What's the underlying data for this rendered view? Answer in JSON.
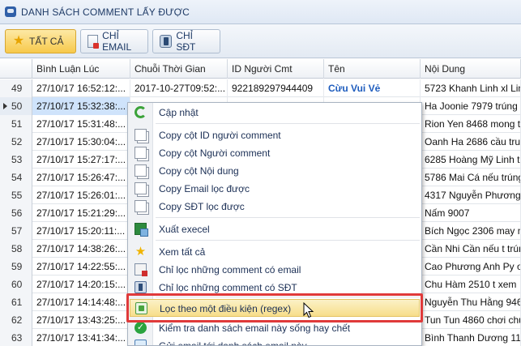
{
  "window": {
    "title": "DANH SÁCH COMMENT LẤY ĐƯỢC",
    "icon": "comment-icon"
  },
  "toolbar": {
    "all_label": "TẤT CẢ",
    "email_label": "CHỈ EMAIL",
    "phone_label": "CHỈ SĐT"
  },
  "grid": {
    "columns": [
      "Bình Luận Lúc",
      "Chuỗi Thời Gian",
      "ID Người Cmt",
      "Tên",
      "Nội Dung"
    ],
    "rows": [
      {
        "num": "49",
        "time": "27/10/17 16:52:12:...",
        "timestamp": "2017-10-27T09:52:...",
        "user_id": "922189297944409",
        "name": "Cừu Vui Vẻ",
        "content": "5723 Khanh Linh xl Lin"
      },
      {
        "num": "50",
        "time": "27/10/17 15:32:38:...",
        "content": "Ha Joonie 7979 trúng c"
      },
      {
        "num": "51",
        "time": "27/10/17 15:31:48:...",
        "content": "Rion Yen 8468 mong tr"
      },
      {
        "num": "52",
        "time": "27/10/17 15:30:04:...",
        "content": "Oanh Ha  2686  cầu tru"
      },
      {
        "num": "53",
        "time": "27/10/17 15:27:17:...",
        "content": "6285 Hoàng Mỹ Linh t"
      },
      {
        "num": "54",
        "time": "27/10/17 15:26:47:...",
        "content": "5786 Mai Cá nếu trúng"
      },
      {
        "num": "55",
        "time": "27/10/17 15:26:01:...",
        "content": "4317 Nguyễn Phương"
      },
      {
        "num": "56",
        "time": "27/10/17 15:21:29:...",
        "content": "Nấm 9007"
      },
      {
        "num": "57",
        "time": "27/10/17 15:20:11:...",
        "content": "Bích Ngọc 2306 may n"
      },
      {
        "num": "58",
        "time": "27/10/17 14:38:26:...",
        "content": "Cần Nhi Cần nếu t trún"
      },
      {
        "num": "59",
        "time": "27/10/17 14:22:55:...",
        "content": "Cao Phương Anh Py o"
      },
      {
        "num": "60",
        "time": "27/10/17 14:20:15:...",
        "content": "Chu Hàm 2510 t xem"
      },
      {
        "num": "61",
        "time": "27/10/17 14:14:48:...",
        "content": "Nguyễn Thu Hằng 946"
      },
      {
        "num": "62",
        "time": "27/10/17 13:43:25:...",
        "content": "Tun Tun 4860 chơi chu"
      },
      {
        "num": "63",
        "time": "27/10/17 13:41:34:...",
        "content": "Bình Thanh Dương 11"
      }
    ]
  },
  "context_menu": {
    "items": [
      {
        "label": "Cập nhật",
        "icon": "refresh-icon"
      },
      {
        "label": "Copy cột ID người comment",
        "icon": "copy-icon"
      },
      {
        "label": "Copy cột Người comment",
        "icon": "copy-icon"
      },
      {
        "label": "Copy cột Nội dung",
        "icon": "copy-icon"
      },
      {
        "label": "Copy Email lọc được",
        "icon": "copy-icon"
      },
      {
        "label": "Copy SĐT lọc được",
        "icon": "copy-icon"
      },
      {
        "label": "Xuất execel",
        "icon": "excel-icon"
      },
      {
        "label": "Xem tất cả",
        "icon": "star-icon"
      },
      {
        "label": "Chỉ lọc những comment có email",
        "icon": "email-icon"
      },
      {
        "label": "Chỉ lọc những comment có SĐT",
        "icon": "phone-icon"
      },
      {
        "label": "Lọc theo một điều kiện (regex)",
        "icon": "filter-icon"
      },
      {
        "label": "Kiểm tra danh sách email này sống hay chết",
        "icon": "check-icon"
      },
      {
        "label": "Gửi email tới danh sách email này",
        "icon": "send-icon"
      }
    ]
  },
  "colors": {
    "highlight_border": "#e03a3a",
    "accent": "#f7c94b",
    "name_link": "#1f5dbe"
  }
}
